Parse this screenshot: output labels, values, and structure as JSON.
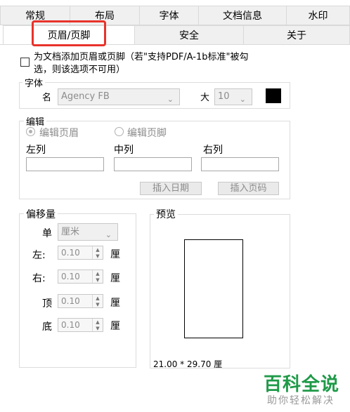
{
  "tabs_row1": [
    "常规",
    "布局",
    "字体",
    "文档信息",
    "水印"
  ],
  "tabs_row2": [
    "页眉/页脚",
    "安全",
    "关于"
  ],
  "checkbox": {
    "label_line1": "为文档添加页眉或页脚（若\"支持PDF/A-1b标准\"被勾",
    "label_line2": "选，则该选项不可用）"
  },
  "font_group": {
    "title": "字体",
    "name_label": "名",
    "name_value": "Agency FB",
    "size_label": "大",
    "size_value": "10",
    "color": "#000000"
  },
  "edit_group": {
    "title": "编辑",
    "radio_header": "编辑页眉",
    "radio_footer": "编辑页脚",
    "left_col": "左列",
    "mid_col": "中列",
    "right_col": "右列",
    "insert_date": "插入日期",
    "insert_page": "插入页码"
  },
  "offset_group": {
    "title": "偏移量",
    "unit_label": "单",
    "unit_value": "厘米",
    "left_label": "左:",
    "left_value": "0.10",
    "right_label": "右:",
    "right_value": "0.10",
    "top_label": "顶",
    "top_value": "0.10",
    "bottom_label": "底",
    "bottom_value": "0.10",
    "unit_suffix": "厘"
  },
  "preview_group": {
    "title": "预览",
    "size_text": "21.00 * 29.70 厘"
  },
  "watermark": {
    "title": "百科全说",
    "subtitle": "助你轻松解决"
  },
  "colors": {
    "highlight": "#e8322b",
    "watermark_green": "#1f9a48"
  }
}
